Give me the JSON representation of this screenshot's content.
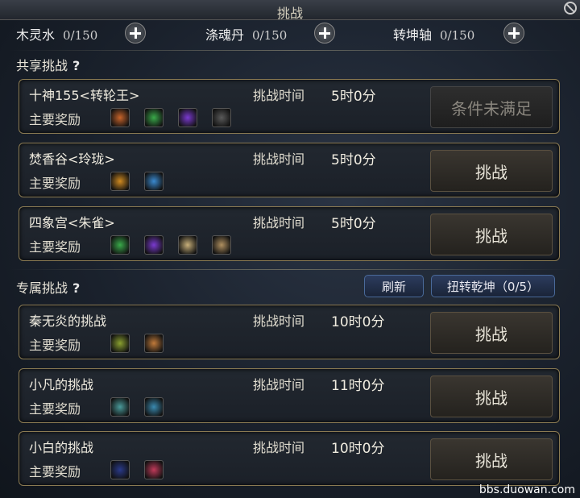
{
  "window": {
    "title": "挑战"
  },
  "resources": [
    {
      "name": "木灵水",
      "amount": "0/150"
    },
    {
      "name": "涤魂丹",
      "amount": "0/150"
    },
    {
      "name": "转坤轴",
      "amount": "0/150"
    }
  ],
  "shared": {
    "title": "共享挑战",
    "help": "?",
    "cards": [
      {
        "name": "十神155<转轮王>",
        "time_label": "挑战时间",
        "time": "5时0分",
        "reward_label": "主要奖励",
        "button": "条件未满足",
        "disabled": true,
        "icons": [
          {
            "name": "orange-orb-icon",
            "color": "#c8642a"
          },
          {
            "name": "green-orb-icon",
            "color": "#3aaa4a"
          },
          {
            "name": "purple-orb-icon",
            "color": "#7a3ad0"
          },
          {
            "name": "grey-scroll-icon",
            "color": "#5a5a5a"
          }
        ]
      },
      {
        "name": "焚香谷<玲珑>",
        "time_label": "挑战时间",
        "time": "5时0分",
        "reward_label": "主要奖励",
        "button": "挑战",
        "disabled": false,
        "icons": [
          {
            "name": "fan-icon",
            "color": "#d08a20"
          },
          {
            "name": "gift-box-icon",
            "color": "#3a8ad0"
          }
        ]
      },
      {
        "name": "四象宫<朱雀>",
        "time_label": "挑战时间",
        "time": "5时0分",
        "reward_label": "主要奖励",
        "button": "挑战",
        "disabled": false,
        "icons": [
          {
            "name": "green-orb-icon",
            "color": "#3aaa4a"
          },
          {
            "name": "purple-orb-icon",
            "color": "#7a3ad0"
          },
          {
            "name": "paper-scroll-icon",
            "color": "#c8b07a"
          },
          {
            "name": "tan-scroll-icon",
            "color": "#b09060"
          }
        ]
      }
    ]
  },
  "exclusive": {
    "title": "专属挑战",
    "help": "?",
    "refresh_label": "刷新",
    "twist_label": "扭转乾坤（0/5）",
    "cards": [
      {
        "name": "秦无炎的挑战",
        "time_label": "挑战时间",
        "time": "10时0分",
        "reward_label": "主要奖励",
        "button": "挑战",
        "disabled": false,
        "icons": [
          {
            "name": "green-scroll-icon",
            "color": "#8aa030"
          },
          {
            "name": "food-plate-icon",
            "color": "#c07a3a"
          }
        ]
      },
      {
        "name": "小凡的挑战",
        "time_label": "挑战时间",
        "time": "11时0分",
        "reward_label": "主要奖励",
        "button": "挑战",
        "disabled": false,
        "icons": [
          {
            "name": "book-icon",
            "color": "#4a9a9a"
          },
          {
            "name": "cloud-icon",
            "color": "#3a8ab0"
          }
        ]
      },
      {
        "name": "小白的挑战",
        "time_label": "挑战时间",
        "time": "10时0分",
        "reward_label": "主要奖励",
        "button": "挑战",
        "disabled": false,
        "icons": [
          {
            "name": "blue-card-icon",
            "color": "#2a3a8a"
          },
          {
            "name": "firework-icon",
            "color": "#c03a5a"
          }
        ]
      }
    ]
  },
  "watermark": "bbs.duowan.com"
}
